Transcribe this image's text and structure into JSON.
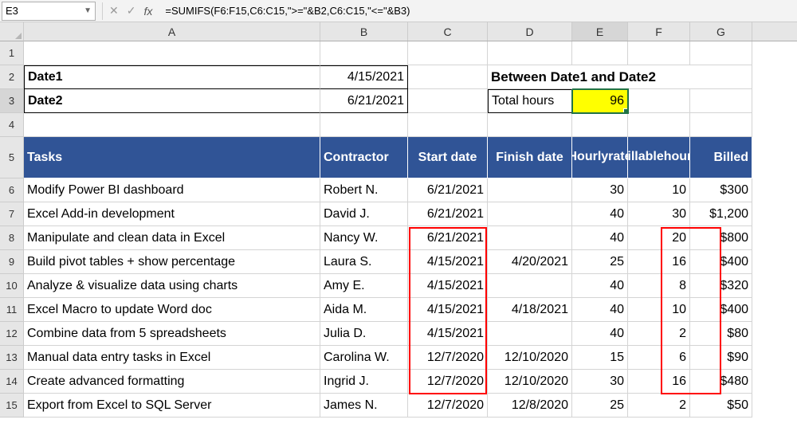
{
  "name_box": "E3",
  "formula": "=SUMIFS(F6:F15,C6:C15,\">=\"&B2,C6:C15,\"<=\"&B3)",
  "columns": [
    "A",
    "B",
    "C",
    "D",
    "E",
    "F",
    "G"
  ],
  "row_nums": [
    "1",
    "2",
    "3",
    "4",
    "5",
    "6",
    "7",
    "8",
    "9",
    "10",
    "11",
    "12",
    "13",
    "14",
    "15"
  ],
  "date1_label": "Date1",
  "date2_label": "Date2",
  "date1_value": "4/15/2021",
  "date2_value": "6/21/2021",
  "between_label": "Between Date1 and Date2",
  "total_hours_label": "Total hours",
  "total_hours_value": "96",
  "headers": {
    "tasks": "Tasks",
    "contractor": "Contractor",
    "start": "Start date",
    "finish": "Finish date",
    "hourly1": "Hourly",
    "hourly2": "rate",
    "billable1": "Billable",
    "billable2": "hours",
    "billed": "Billed"
  },
  "rows": [
    {
      "task": "Modify Power BI dashboard",
      "contractor": "Robert N.",
      "start": "6/21/2021",
      "finish": "",
      "rate": "30",
      "hours": "10",
      "billed": "$300"
    },
    {
      "task": "Excel Add-in development",
      "contractor": "David J.",
      "start": "6/21/2021",
      "finish": "",
      "rate": "40",
      "hours": "30",
      "billed": "$1,200"
    },
    {
      "task": "Manipulate and clean data in Excel",
      "contractor": "Nancy W.",
      "start": "6/21/2021",
      "finish": "",
      "rate": "40",
      "hours": "20",
      "billed": "$800"
    },
    {
      "task": "Build pivot tables + show percentage",
      "contractor": "Laura S.",
      "start": "4/15/2021",
      "finish": "4/20/2021",
      "rate": "25",
      "hours": "16",
      "billed": "$400"
    },
    {
      "task": "Analyze & visualize data using charts",
      "contractor": "Amy E.",
      "start": "4/15/2021",
      "finish": "",
      "rate": "40",
      "hours": "8",
      "billed": "$320"
    },
    {
      "task": "Excel Macro to update Word doc",
      "contractor": "Aida M.",
      "start": "4/15/2021",
      "finish": "4/18/2021",
      "rate": "40",
      "hours": "10",
      "billed": "$400"
    },
    {
      "task": "Combine data from 5 spreadsheets",
      "contractor": "Julia D.",
      "start": "4/15/2021",
      "finish": "",
      "rate": "40",
      "hours": "2",
      "billed": "$80"
    },
    {
      "task": "Manual data entry tasks in Excel",
      "contractor": "Carolina W.",
      "start": "12/7/2020",
      "finish": "12/10/2020",
      "rate": "15",
      "hours": "6",
      "billed": "$90"
    },
    {
      "task": "Create advanced formatting",
      "contractor": "Ingrid J.",
      "start": "12/7/2020",
      "finish": "12/10/2020",
      "rate": "30",
      "hours": "16",
      "billed": "$480"
    },
    {
      "task": "Export from Excel to SQL Server",
      "contractor": "James N.",
      "start": "12/7/2020",
      "finish": "12/8/2020",
      "rate": "25",
      "hours": "2",
      "billed": "$50"
    }
  ]
}
